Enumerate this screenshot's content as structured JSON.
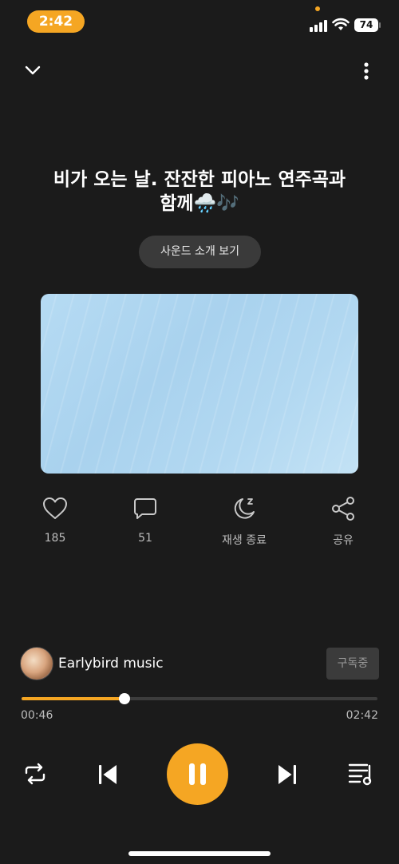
{
  "status_bar": {
    "time": "2:42",
    "battery": "74"
  },
  "track": {
    "title_line1": "비가 오는 날. 잔잔한 피아노 연주곡과",
    "title_line2": "함께🌧️🎶",
    "intro_button": "사운드 소개 보기"
  },
  "actions": {
    "like_count": "185",
    "comment_count": "51",
    "sleep_timer_label": "재생 종료",
    "share_label": "공유"
  },
  "artist": {
    "name": "Earlybird music",
    "subscribe_label": "구독중"
  },
  "playback": {
    "elapsed": "00:46",
    "total": "02:42",
    "progress": 0.29
  },
  "colors": {
    "accent": "#f5a623",
    "background": "#1b1b1b"
  },
  "icons": {
    "collapse": "chevron-down-icon",
    "more": "more-vertical-icon",
    "like": "heart-icon",
    "comment": "comment-icon",
    "sleep": "moon-sleep-icon",
    "share": "share-icon",
    "repeat": "repeat-icon",
    "previous": "skip-previous-icon",
    "pause": "pause-icon",
    "next": "skip-next-icon",
    "playlist": "playlist-icon"
  }
}
